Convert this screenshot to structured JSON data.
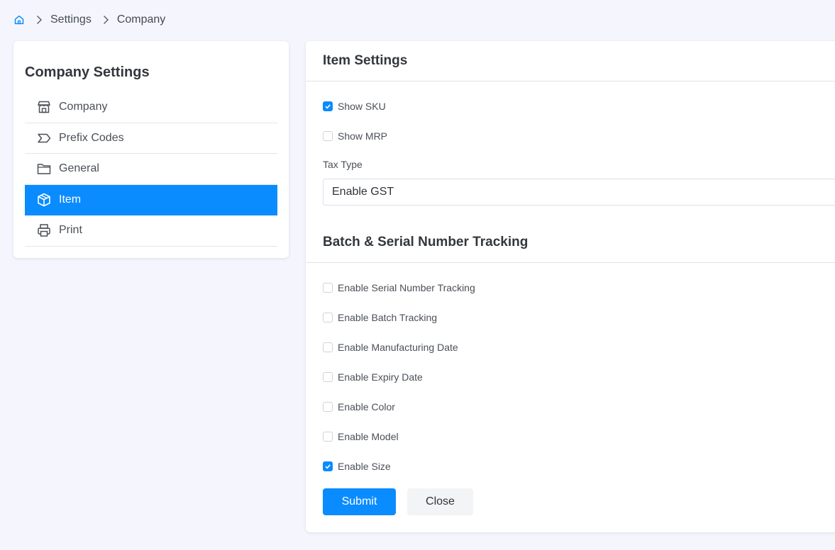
{
  "breadcrumb": {
    "items": [
      "Settings",
      "Company"
    ]
  },
  "sidebar": {
    "title": "Company Settings",
    "items": [
      {
        "label": "Company",
        "icon": "store-icon"
      },
      {
        "label": "Prefix Codes",
        "icon": "tag-icon"
      },
      {
        "label": "General",
        "icon": "folder-icon"
      },
      {
        "label": "Item",
        "icon": "box-icon",
        "active": true
      },
      {
        "label": "Print",
        "icon": "printer-icon"
      }
    ]
  },
  "item_settings": {
    "title": "Item Settings",
    "show_sku": {
      "label": "Show SKU",
      "checked": true
    },
    "show_mrp": {
      "label": "Show MRP",
      "checked": false
    },
    "tax_type_label": "Tax Type",
    "tax_type_value": "Enable GST"
  },
  "tracking": {
    "title": "Batch & Serial Number Tracking",
    "options": [
      {
        "label": "Enable Serial Number Tracking",
        "checked": false
      },
      {
        "label": "Enable Batch Tracking",
        "checked": false
      },
      {
        "label": "Enable Manufacturing Date",
        "checked": false
      },
      {
        "label": "Enable Expiry Date",
        "checked": false
      },
      {
        "label": "Enable Color",
        "checked": false
      },
      {
        "label": "Enable Model",
        "checked": false
      },
      {
        "label": "Enable Size",
        "checked": true
      }
    ]
  },
  "actions": {
    "submit": "Submit",
    "close": "Close"
  },
  "colors": {
    "accent": "#0a8cff",
    "background": "#f5f6fd"
  }
}
